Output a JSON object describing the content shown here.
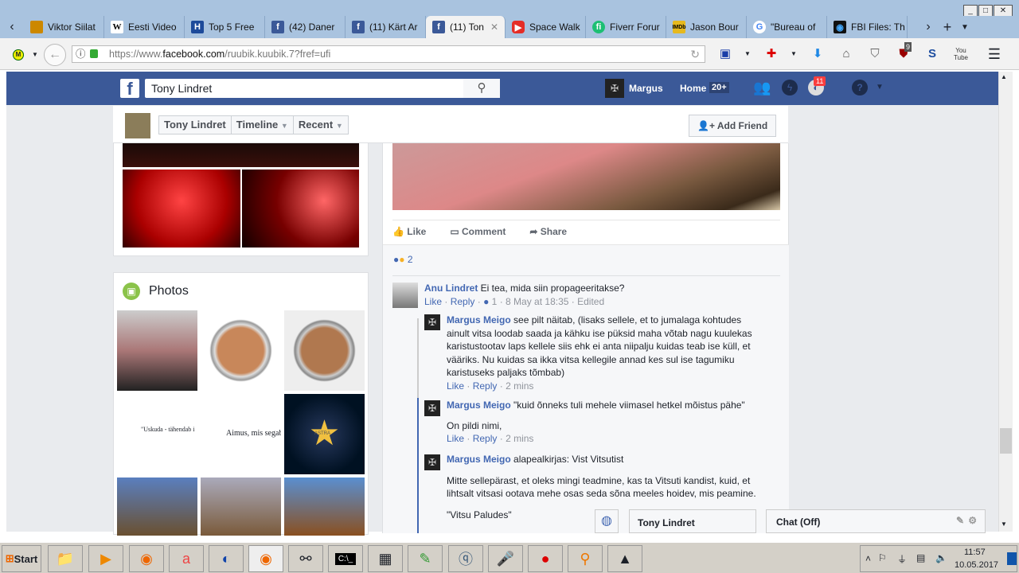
{
  "browser": {
    "tabs": [
      {
        "label": "Viktor Siilat",
        "icon": "generic"
      },
      {
        "label": "Eesti Video",
        "icon": "wikipedia-icon"
      },
      {
        "label": "Top 5 Free",
        "icon": "h-icon"
      },
      {
        "label": "(42) Daner",
        "icon": "facebook-icon"
      },
      {
        "label": "(11) Kärt Ar",
        "icon": "facebook-icon"
      },
      {
        "label": "(11) Ton",
        "icon": "facebook-icon",
        "active": true
      },
      {
        "label": "Space Walk",
        "icon": "youtube-icon"
      },
      {
        "label": "Fiverr Forur",
        "icon": "fiverr-icon"
      },
      {
        "label": "Jason Bour",
        "icon": "imdb-icon"
      },
      {
        "label": "\"Bureau of",
        "icon": "google-icon"
      },
      {
        "label": "FBI Files: Th",
        "icon": "fbi-icon"
      }
    ],
    "url_prefix": "https://www.",
    "url_domain": "facebook.com",
    "url_path": "/ruubik.kuubik.7?fref=ufi",
    "ublock_count": "9"
  },
  "fb": {
    "search_value": "Tony Lindret",
    "user": "Margus",
    "home": "Home",
    "home_badge": "20+",
    "notif_count": "11",
    "profile_name": "Tony Lindret",
    "timeline": "Timeline",
    "recent": "Recent",
    "add_friend": "Add Friend",
    "photos_title": "Photos",
    "photo_caption_1": "\"Uskuda - tähendab i",
    "photo_caption_2": "Aimus, mis segab õpp",
    "photo_caption_3": "ASTRA",
    "actions": {
      "like": "Like",
      "comment": "Comment",
      "share": "Share"
    },
    "reaction_count": "2",
    "comments": [
      {
        "author": "Anu Lindret",
        "text": "Ei tea, mida siin propageeritakse?",
        "like": "Like",
        "reply": "Reply",
        "likes": "1",
        "time": "8 May at 18:35",
        "edited": "Edited"
      },
      {
        "author": "Margus Meigo",
        "text": "see pilt näitab, (lisaks sellele, et to jumalaga kohtudes ainult vitsa loodab saada ja kähku ise püksid maha võtab nagu kuulekas karistustootav laps kellele siis ehk ei anta niipalju kuidas teab ise küll, et vääriks. Nu kuidas sa ikka vitsa kellegile annad kes sul ise tagumiku karistuseks paljaks tõmbab)",
        "like": "Like",
        "reply": "Reply",
        "time": "2 mins"
      },
      {
        "author": "Margus Meigo",
        "text": "\"kuid õnneks tuli mehele viimasel hetkel mõistus pähe\"",
        "text2": "On pildi nimi,",
        "like": "Like",
        "reply": "Reply",
        "time": "2 mins"
      },
      {
        "author": "Margus Meigo",
        "text": "alapealkirjas: Vist Vitsutist",
        "text2": "Mitte sellepärast, et oleks mingi teadmine, kas ta Vitsuti kandist, kuid, et lihtsalt vitsasi ootava mehe osas seda sõna meeles hoidev, mis peamine.",
        "text3": "\"Vitsu Paludes\""
      }
    ],
    "chat_tab": "Tony Lindret",
    "chat_status": "Chat (Off)"
  },
  "taskbar": {
    "start": "Start",
    "time": "11:57",
    "date": "10.05.2017"
  }
}
